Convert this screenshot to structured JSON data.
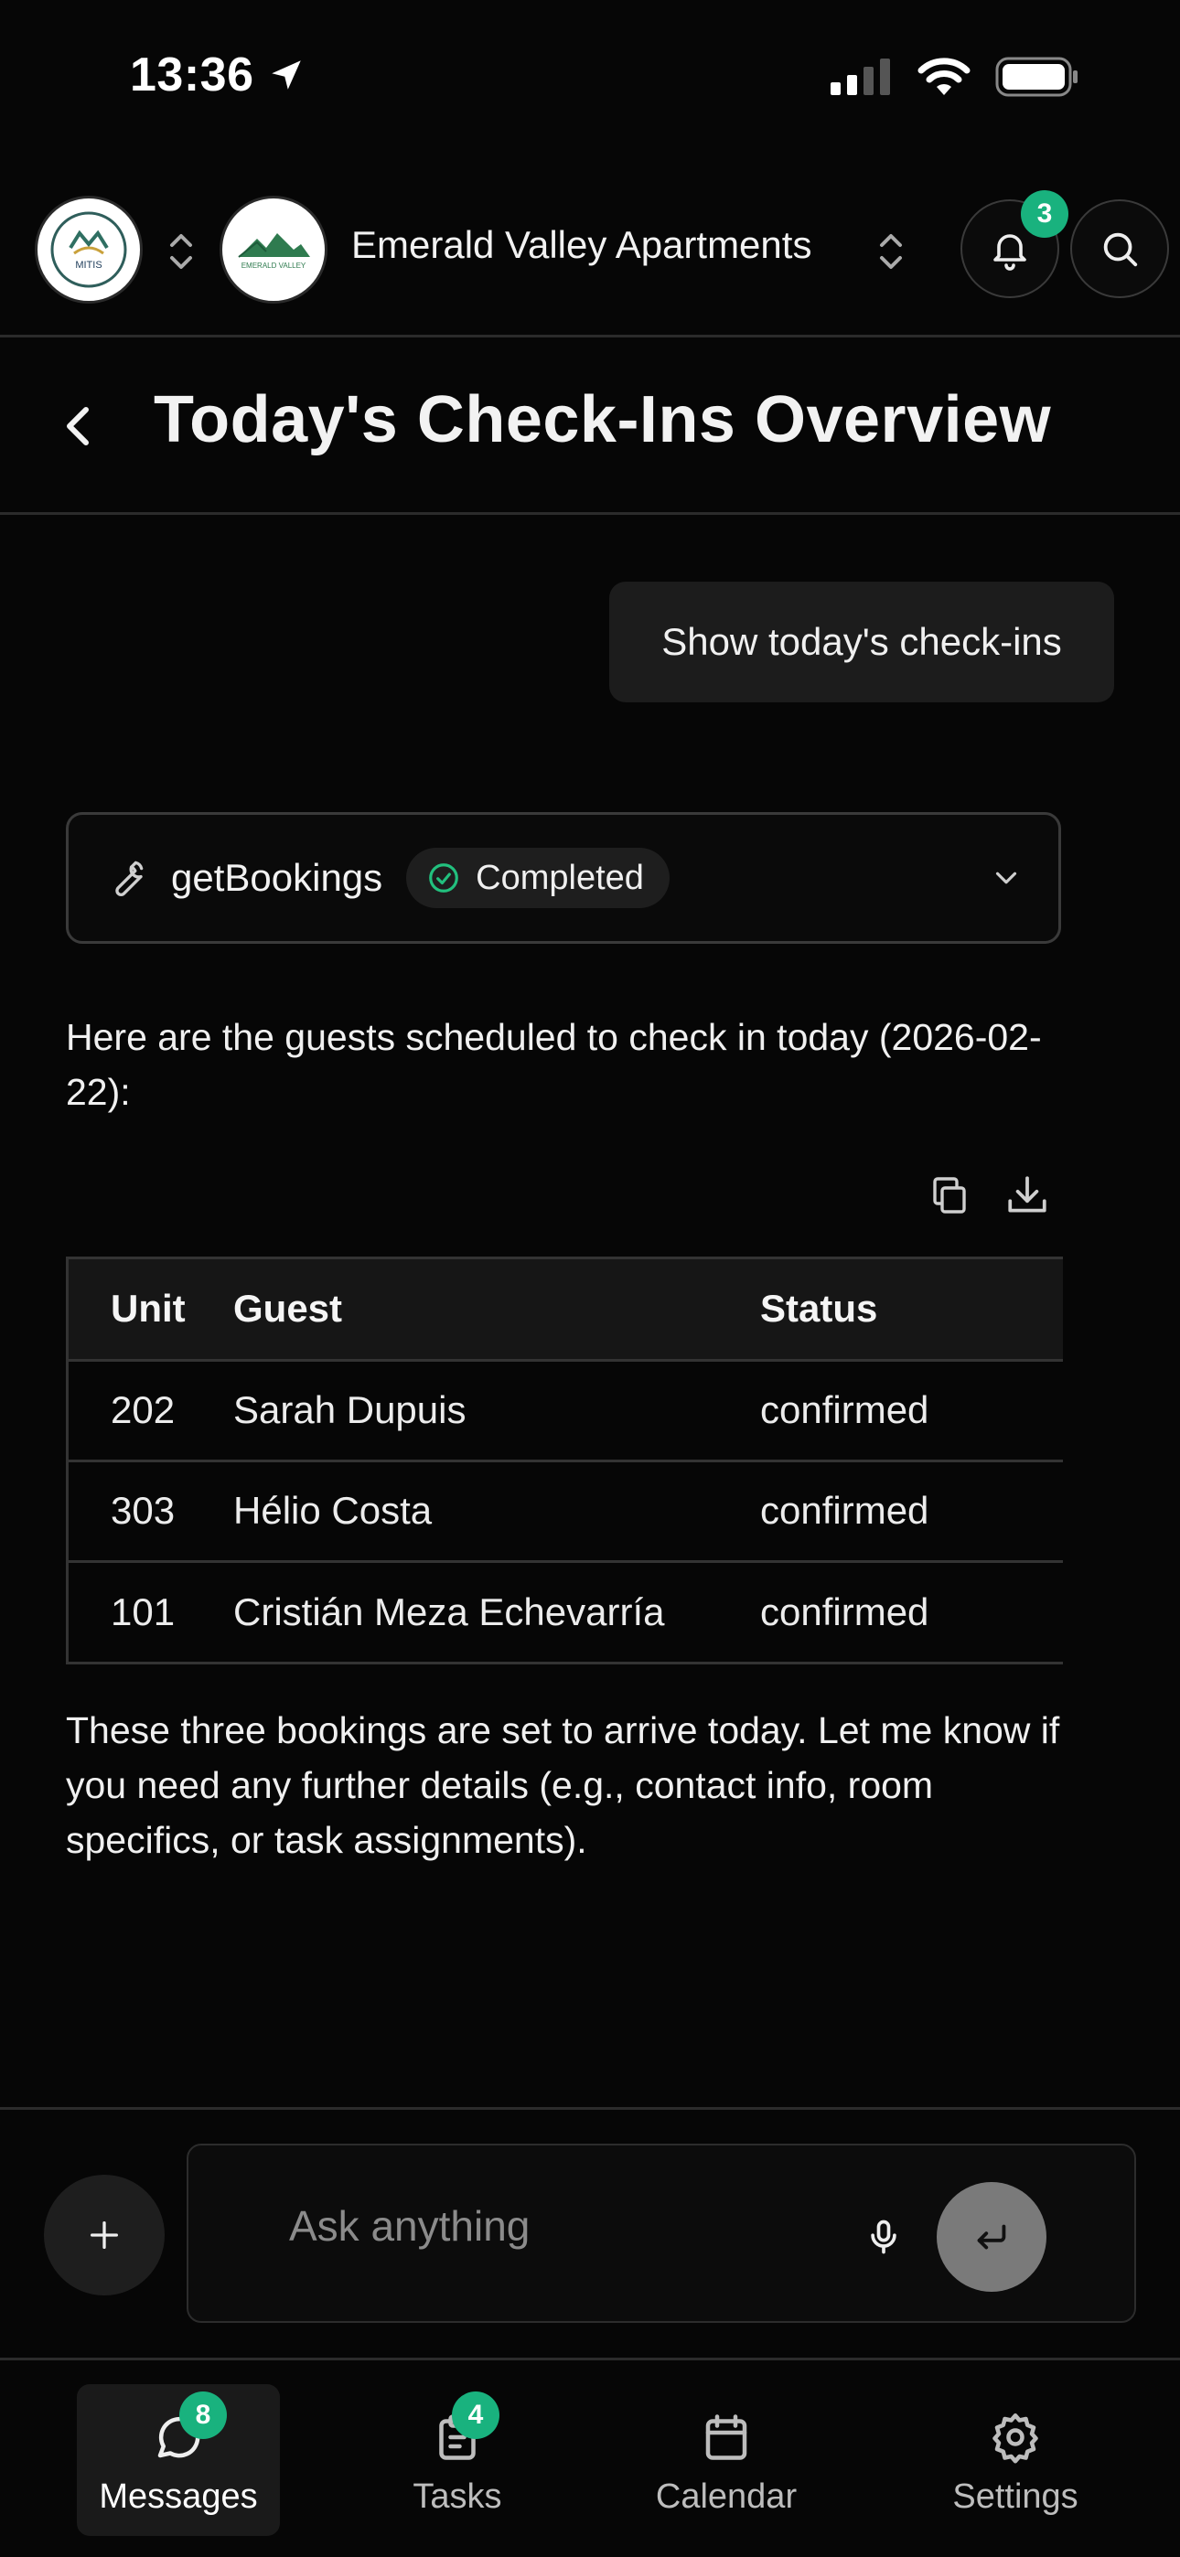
{
  "status_bar": {
    "time": "13:36"
  },
  "header": {
    "org_logo_text": "MITIS",
    "property_logo_text": "EMERALD VALLEY",
    "property_name": "Emerald Valley Apartments",
    "notification_count": "3"
  },
  "page": {
    "title": "Today's Check-Ins Overview"
  },
  "chat": {
    "user_message": "Show today's check-ins",
    "tool_call": {
      "name": "getBookings",
      "status": "Completed"
    },
    "intro_text": "Here are the guests scheduled to check in today (2026-02-22):",
    "table": {
      "headers": [
        "Unit",
        "Guest",
        "Status"
      ],
      "rows": [
        [
          "202",
          "Sarah Dupuis",
          "confirmed"
        ],
        [
          "303",
          "Hélio Costa",
          "confirmed"
        ],
        [
          "101",
          "Cristián Meza Echevarría",
          "confirmed"
        ]
      ]
    },
    "closing_text": "These three bookings are set to arrive today. Let me know if you need any further details (e.g., contact info, room specifics, or task assignments)."
  },
  "composer": {
    "placeholder": "Ask anything"
  },
  "tabs": [
    {
      "label": "Messages",
      "badge": "8",
      "icon": "chat-bubble-icon",
      "active": true
    },
    {
      "label": "Tasks",
      "badge": "4",
      "icon": "clipboard-icon",
      "active": false
    },
    {
      "label": "Calendar",
      "badge": "",
      "icon": "calendar-icon",
      "active": false
    },
    {
      "label": "Settings",
      "badge": "",
      "icon": "gear-icon",
      "active": false
    }
  ],
  "colors": {
    "accent_badge": "#19b27e",
    "background": "#060606",
    "surface": "#1c1c1c"
  }
}
